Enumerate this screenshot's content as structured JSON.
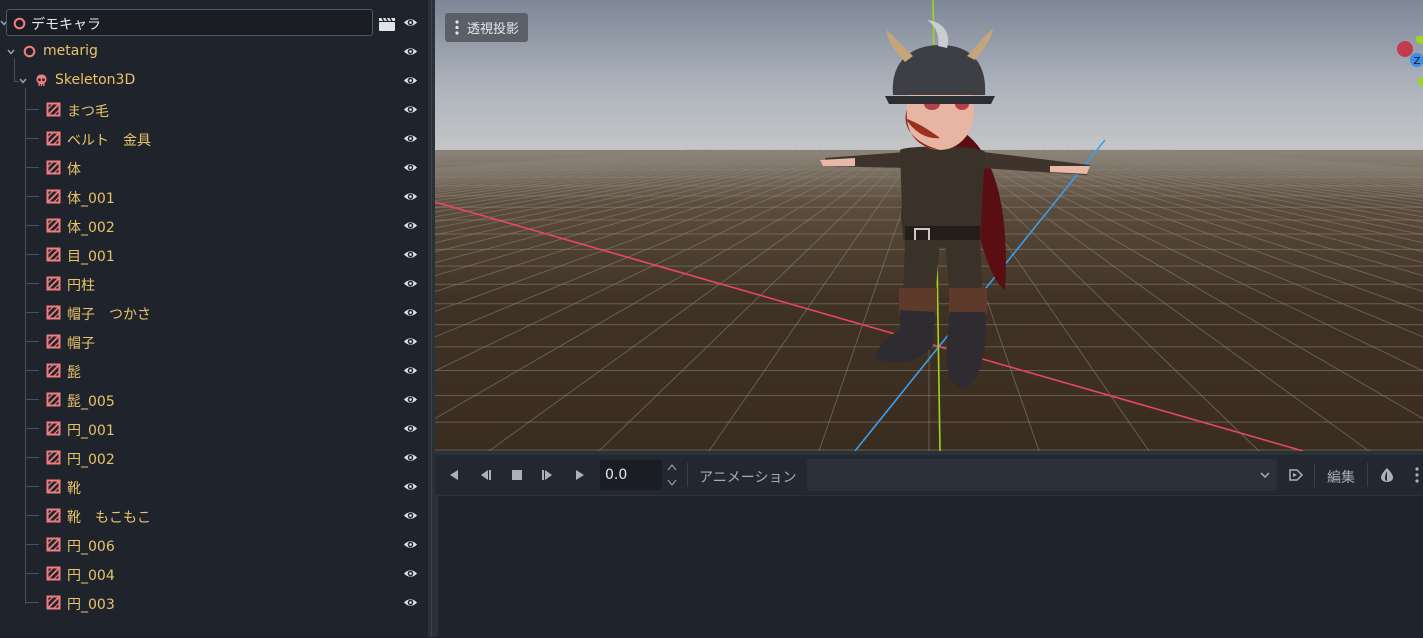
{
  "scene_tree": {
    "root": {
      "name": "デモキャラ",
      "icon": "node3d-icon",
      "color": "#f07e7e"
    },
    "armature": {
      "name": "metarig",
      "icon": "node3d-icon"
    },
    "skeleton": {
      "name": "Skeleton3D",
      "icon": "skeleton-icon"
    },
    "meshes": [
      {
        "name": "まつ毛"
      },
      {
        "name": "ベルト　金具"
      },
      {
        "name": "体"
      },
      {
        "name": "体_001"
      },
      {
        "name": "体_002"
      },
      {
        "name": "目_001"
      },
      {
        "name": "円柱"
      },
      {
        "name": "帽子　つかさ"
      },
      {
        "name": "帽子"
      },
      {
        "name": "髭"
      },
      {
        "name": "髭_005"
      },
      {
        "name": "円_001"
      },
      {
        "name": "円_002"
      },
      {
        "name": "靴"
      },
      {
        "name": "靴　もこもこ"
      },
      {
        "name": "円_006"
      },
      {
        "name": "円_004"
      },
      {
        "name": "円_003"
      }
    ],
    "mesh_icon": "mesh-instance-icon",
    "visibility_icon": "eye-icon",
    "node_color": "#e8c368"
  },
  "viewport": {
    "projection_label": "透視投影",
    "gizmo": {
      "z_label": "Z"
    },
    "colors": {
      "x_axis": "#e8475f",
      "y_axis": "#9fd421",
      "z_axis": "#3d9df0",
      "ground": "#3b2f22"
    }
  },
  "animation_panel": {
    "time_value": "0.0",
    "animation_label": "アニメーション",
    "edit_label": "編集",
    "selected_animation": ""
  },
  "colors": {
    "accent": "#e8c368",
    "panel_bg": "#1f242c",
    "text": "#cdd2d8"
  }
}
